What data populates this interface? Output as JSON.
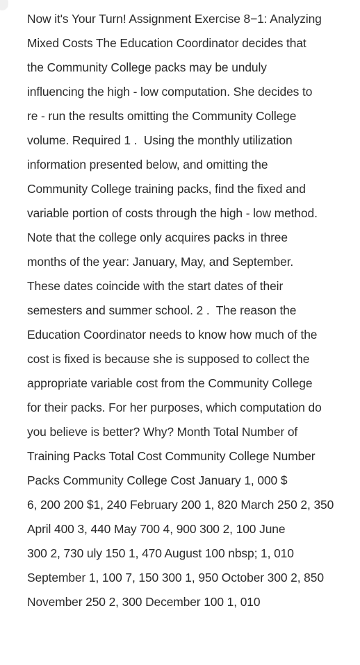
{
  "document": {
    "type": "plain-text-passage",
    "title": "Now it's Your Turn! Assignment Exercise 8−1: Analyzing Mixed Costs",
    "text_color": "#2b2b2b",
    "background_color": "#ffffff",
    "marker_color": "#f0f0f0",
    "lines": [
      "Now it's Your Turn! Assignment Exercise 8−1: Analyzing",
      "Mixed Costs The Education Coordinator decides that",
      "the Community College packs may be unduly",
      "influencing the high - low computation. She decides to",
      "re - run the results omitting the Community College",
      "volume. Required 1 .  Using the monthly utilization",
      "information presented below, and omitting the",
      "Community College training packs, find the fixed and",
      "variable portion of costs through the high - low method.",
      "Note that the college only acquires packs in three",
      "months of the year: January, May, and September.",
      "These dates coincide with the start dates of their",
      "semesters and summer school. 2 .  The reason the",
      "Education Coordinator needs to know how much of the",
      "cost is fixed is because she is supposed to collect the",
      "appropriate variable cost from the Community College",
      "for their packs. For her purposes, which computation do",
      "you believe is better? Why? Month Total Number of",
      "Training Packs Total Cost Community College Number",
      "Packs Community College Cost January 1, 000 $",
      "6, 200 200 $1, 240 February 200 1, 820 March 250 2, 350",
      "April 400 3, 440 May 700 4, 900 300 2, 100 June",
      "300 2, 730 uly 150 1, 470 August 100 nbsp; 1, 010",
      "September 1, 100 7, 150 300 1, 950 October 300 2, 850",
      "November 250 2, 300 December 100 1, 010"
    ],
    "table_data": {
      "columns": [
        "Month",
        "Total Number of Training Packs",
        "Total Cost",
        "Community College Number Packs",
        "Community College Cost"
      ],
      "rows": [
        [
          "January",
          "1, 000",
          "$ 6, 200",
          "200",
          "$1, 240"
        ],
        [
          "February",
          "200",
          "1, 820",
          "",
          ""
        ],
        [
          "March",
          "250",
          "2, 350",
          "",
          ""
        ],
        [
          "April",
          "400",
          "3, 440",
          "",
          ""
        ],
        [
          "May",
          "700",
          "4, 900",
          "300",
          "2, 100"
        ],
        [
          "June",
          "300",
          "2, 730",
          "",
          ""
        ],
        [
          "uly",
          "150",
          "1, 470",
          "",
          ""
        ],
        [
          "August",
          "100",
          "nbsp; 1, 010",
          "",
          ""
        ],
        [
          "September",
          "1, 100",
          "7, 150",
          "300",
          "1, 950"
        ],
        [
          "October",
          "300",
          "2, 850",
          "",
          ""
        ],
        [
          "November",
          "250",
          "2, 300",
          "",
          ""
        ],
        [
          "December",
          "100",
          "1, 010",
          "",
          ""
        ]
      ]
    }
  }
}
